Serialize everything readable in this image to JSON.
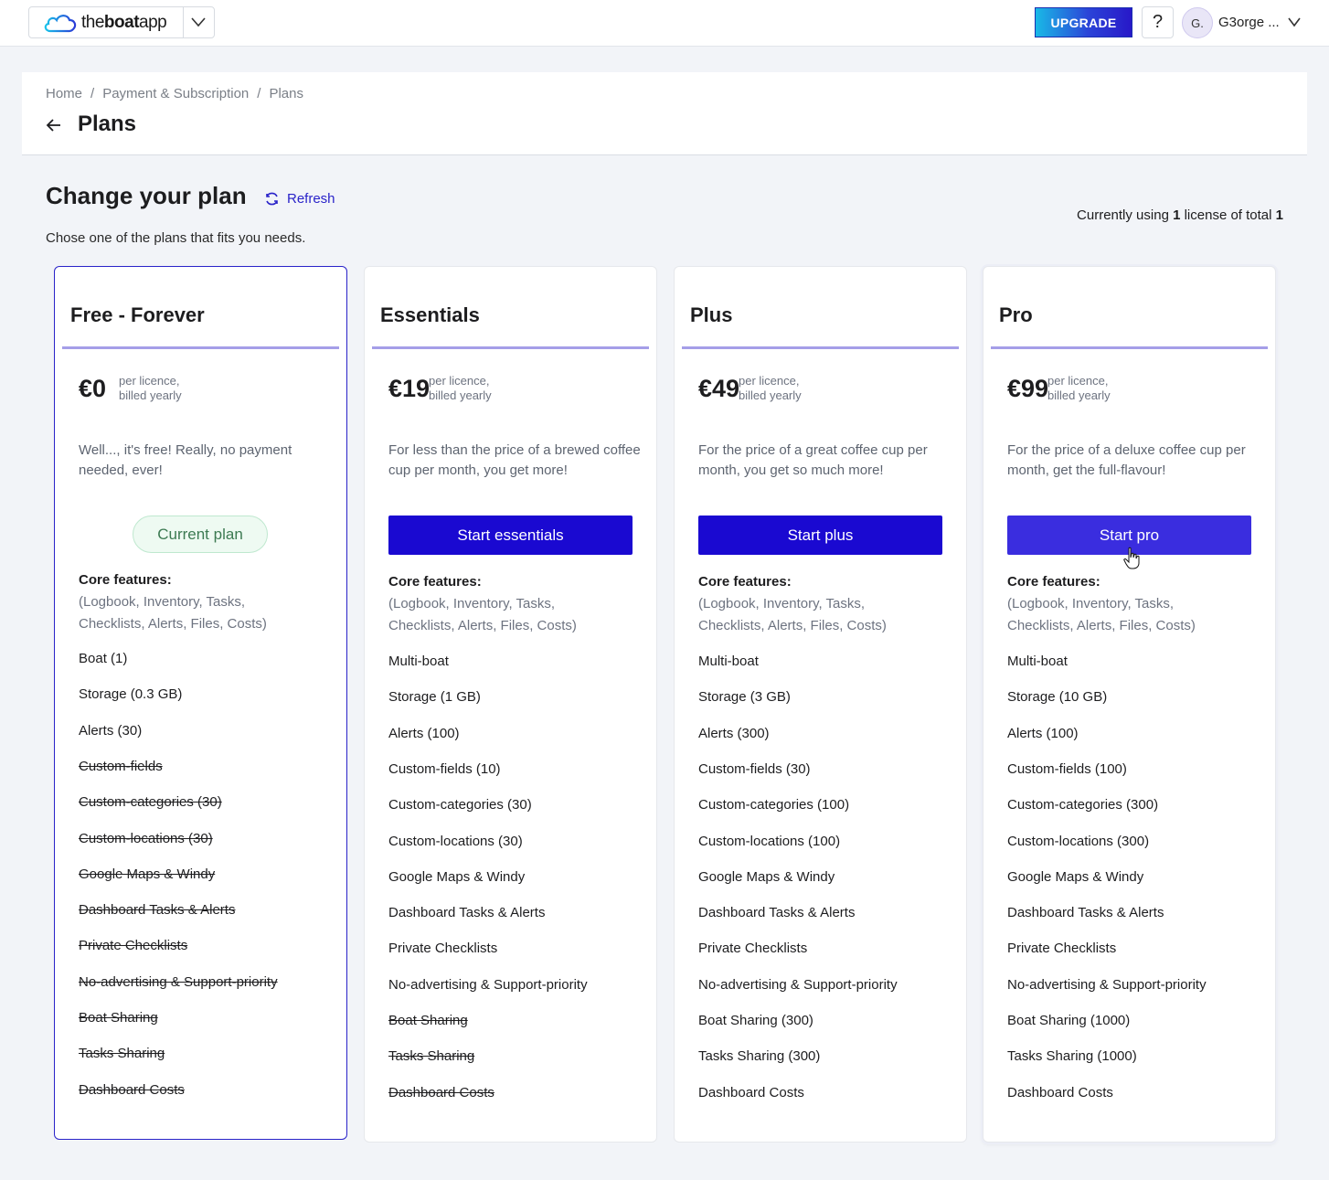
{
  "topbar": {
    "logo_text_light": "the",
    "logo_text_bold": "boat",
    "logo_text_end": "app",
    "upgrade_label": "UPGRADE",
    "help_label": "?",
    "avatar_initial": "G.",
    "user_name": "G3orge ..."
  },
  "breadcrumb": {
    "items": [
      "Home",
      "Payment & Subscription",
      "Plans"
    ],
    "separator": "/"
  },
  "page_title": "Plans",
  "section": {
    "title": "Change your plan",
    "refresh_label": "Refresh",
    "subtitle": "Chose one of the plans that fits you needs.",
    "license_prefix": "Currently using ",
    "license_used": "1",
    "license_middle": " license of total ",
    "license_total": "1"
  },
  "plans": [
    {
      "name": "Free - Forever",
      "price": "€0",
      "price_note_1": "per licence,",
      "price_note_2": "billed yearly",
      "description": "Well..., it's free! Really, no payment needed, ever!",
      "action_label": "Current plan",
      "is_current": true,
      "core_title": "Core features:",
      "core_list": "(Logbook, Inventory, Tasks, Checklists, Alerts, Files, Costs)",
      "features": [
        {
          "label": "Boat (1)",
          "included": true
        },
        {
          "label": "Storage (0.3 GB)",
          "included": true
        },
        {
          "label": "Alerts (30)",
          "included": true
        },
        {
          "label": "Custom-fields",
          "included": false
        },
        {
          "label": "Custom-categories (30)",
          "included": false
        },
        {
          "label": "Custom-locations (30)",
          "included": false
        },
        {
          "label": "Google Maps & Windy",
          "included": false
        },
        {
          "label": "Dashboard Tasks & Alerts",
          "included": false
        },
        {
          "label": "Private Checklists",
          "included": false
        },
        {
          "label": "No-advertising & Support-priority",
          "included": false
        },
        {
          "label": "Boat Sharing",
          "included": false
        },
        {
          "label": "Tasks Sharing",
          "included": false
        },
        {
          "label": "Dashboard Costs",
          "included": false
        }
      ]
    },
    {
      "name": "Essentials",
      "price": "€19",
      "price_note_1": "per licence,",
      "price_note_2": "billed yearly",
      "description": "For less than the price of a brewed coffee cup per month, you get more!",
      "action_label": "Start essentials",
      "is_current": false,
      "core_title": "Core features:",
      "core_list": "(Logbook, Inventory, Tasks, Checklists, Alerts, Files, Costs)",
      "features": [
        {
          "label": "Multi-boat",
          "included": true
        },
        {
          "label": "Storage (1 GB)",
          "included": true
        },
        {
          "label": "Alerts (100)",
          "included": true
        },
        {
          "label": "Custom-fields (10)",
          "included": true
        },
        {
          "label": "Custom-categories (30)",
          "included": true
        },
        {
          "label": "Custom-locations (30)",
          "included": true
        },
        {
          "label": "Google Maps & Windy",
          "included": true
        },
        {
          "label": "Dashboard Tasks & Alerts",
          "included": true
        },
        {
          "label": "Private Checklists",
          "included": true
        },
        {
          "label": "No-advertising & Support-priority",
          "included": true
        },
        {
          "label": "Boat Sharing",
          "included": false
        },
        {
          "label": "Tasks Sharing",
          "included": false
        },
        {
          "label": "Dashboard Costs",
          "included": false
        }
      ]
    },
    {
      "name": "Plus",
      "price": "€49",
      "price_note_1": "per licence,",
      "price_note_2": "billed yearly",
      "description": "For the price of a great coffee cup per month, you get so much more!",
      "action_label": "Start plus",
      "is_current": false,
      "core_title": "Core features:",
      "core_list": "(Logbook, Inventory, Tasks, Checklists, Alerts, Files, Costs)",
      "features": [
        {
          "label": "Multi-boat",
          "included": true
        },
        {
          "label": "Storage (3 GB)",
          "included": true
        },
        {
          "label": "Alerts (300)",
          "included": true
        },
        {
          "label": "Custom-fields (30)",
          "included": true
        },
        {
          "label": "Custom-categories (100)",
          "included": true
        },
        {
          "label": "Custom-locations (100)",
          "included": true
        },
        {
          "label": "Google Maps & Windy",
          "included": true
        },
        {
          "label": "Dashboard Tasks & Alerts",
          "included": true
        },
        {
          "label": "Private Checklists",
          "included": true
        },
        {
          "label": "No-advertising & Support-priority",
          "included": true
        },
        {
          "label": "Boat Sharing (300)",
          "included": true
        },
        {
          "label": "Tasks Sharing (300)",
          "included": true
        },
        {
          "label": "Dashboard Costs",
          "included": true
        }
      ]
    },
    {
      "name": "Pro",
      "price": "€99",
      "price_note_1": "per licence,",
      "price_note_2": "billed yearly",
      "description": "For the price of a deluxe coffee cup per month, get the full-flavour!",
      "action_label": "Start pro",
      "is_current": false,
      "core_title": "Core features:",
      "core_list": "(Logbook, Inventory, Tasks, Checklists, Alerts, Files, Costs)",
      "features": [
        {
          "label": "Multi-boat",
          "included": true
        },
        {
          "label": "Storage (10 GB)",
          "included": true
        },
        {
          "label": "Alerts (100)",
          "included": true
        },
        {
          "label": "Custom-fields (100)",
          "included": true
        },
        {
          "label": "Custom-categories (300)",
          "included": true
        },
        {
          "label": "Custom-locations (300)",
          "included": true
        },
        {
          "label": "Google Maps & Windy",
          "included": true
        },
        {
          "label": "Dashboard Tasks & Alerts",
          "included": true
        },
        {
          "label": "Private Checklists",
          "included": true
        },
        {
          "label": "No-advertising & Support-priority",
          "included": true
        },
        {
          "label": "Boat Sharing (1000)",
          "included": true
        },
        {
          "label": "Tasks Sharing (1000)",
          "included": true
        },
        {
          "label": "Dashboard Costs",
          "included": true
        }
      ]
    }
  ],
  "colors": {
    "accent": "#1a09d1",
    "accent_hover": "#3a2ddf",
    "rule": "#a59ee8",
    "current_pill_bg": "#eefaf2",
    "current_pill_text": "#3c7a52"
  },
  "icons": [
    "cloud-logo-icon",
    "chevron-down-icon",
    "back-arrow-icon",
    "refresh-icon",
    "hand-cursor-icon"
  ]
}
